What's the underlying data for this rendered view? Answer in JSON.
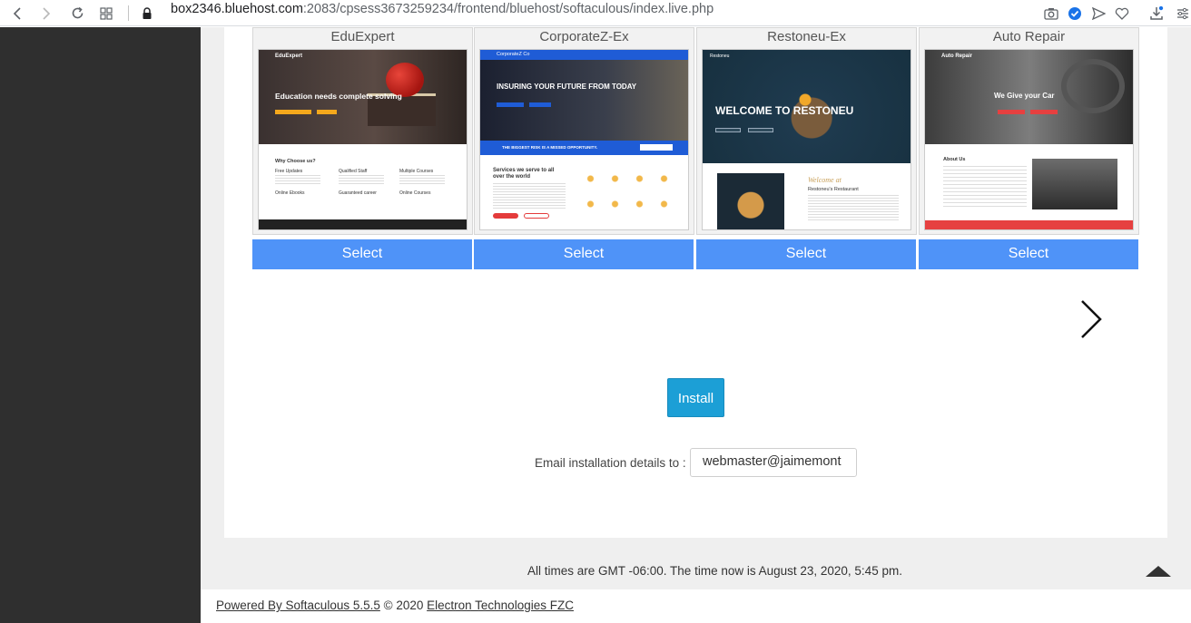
{
  "browser": {
    "url_host": "box2346.bluehost.com",
    "url_rest": ":2083/cpsess3673259234/frontend/bluehost/softaculous/index.live.php"
  },
  "themes": [
    {
      "name": "EduExpert",
      "select_label": "Select",
      "screenshot": {
        "brand": "EduExpert",
        "headline": "Education needs complete solving",
        "section": "Why Choose us?",
        "features": [
          "Free Updates",
          "Qualified Staff",
          "Multiple Courses",
          "Online Ebooks",
          "Guaranteed career",
          "Online Courses"
        ]
      }
    },
    {
      "name": "CorporateZ-Ex",
      "select_label": "Select",
      "screenshot": {
        "brand": "CorporateZ Co",
        "headline": "INSURING YOUR FUTURE FROM TODAY",
        "banner": "THE BIGGEST RISK IS A MISSED OPPORTUNITY.",
        "section": "Services we serve to all over the world"
      }
    },
    {
      "name": "Restoneu-Ex",
      "select_label": "Select",
      "screenshot": {
        "brand": "Restoneu",
        "headline": "WELCOME TO RESTONEU",
        "subhead": "Welcome at",
        "section": "Restoneu's Restaurant"
      }
    },
    {
      "name": "Auto Repair",
      "select_label": "Select",
      "screenshot": {
        "brand": "Auto Repair",
        "headline": "We Give your Car",
        "section": "About Us"
      }
    }
  ],
  "install": {
    "label": "Install"
  },
  "email": {
    "label": "Email installation details to :",
    "value": "webmaster@jaimemont"
  },
  "time_note": "All times are GMT -06:00. The time now is August 23, 2020, 5:45 pm.",
  "footer": {
    "powered_by": "Powered By Softaculous 5.5.5",
    "copyright": "© 2020",
    "company": "Electron Technologies FZC"
  },
  "colors": {
    "select_button": "#4f93f8",
    "install_button": "#1c9fd6",
    "sidebar": "#2f2f2f"
  }
}
